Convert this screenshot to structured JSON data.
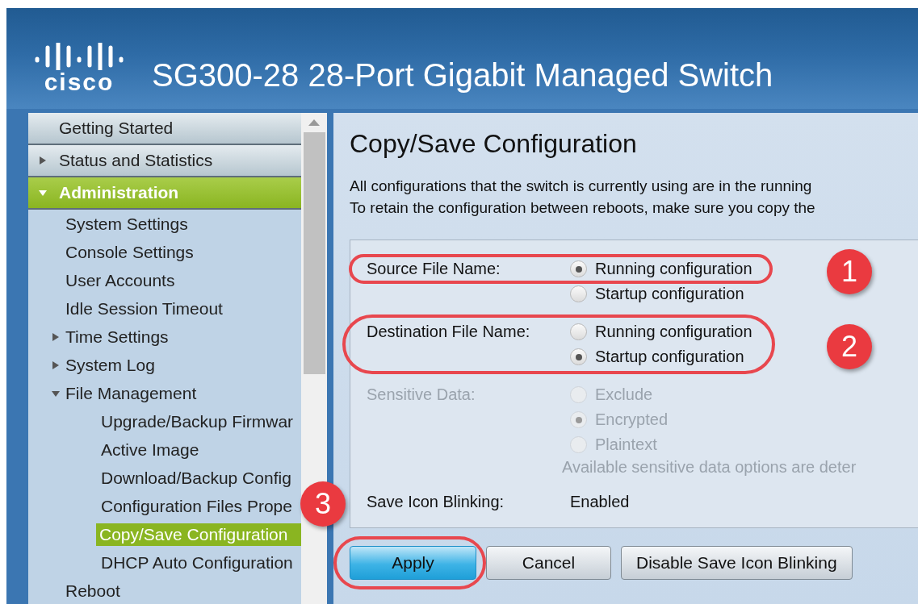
{
  "header": {
    "logo": "cisco",
    "title": "SG300-28 28-Port Gigabit Managed Switch"
  },
  "sidebar": {
    "items": [
      {
        "label": "Getting Started",
        "selected": false
      },
      {
        "label": "Status and Statistics",
        "expanded": false,
        "selected": false
      },
      {
        "label": "Administration",
        "expanded": true,
        "selected": true,
        "children": [
          {
            "label": "System Settings",
            "selected": false
          },
          {
            "label": "Console Settings",
            "selected": false
          },
          {
            "label": "User Accounts",
            "selected": false
          },
          {
            "label": "Idle Session Timeout",
            "selected": false
          },
          {
            "label": "Time Settings",
            "expanded": false,
            "selected": false
          },
          {
            "label": "System Log",
            "expanded": false,
            "selected": false
          },
          {
            "label": "File Management",
            "expanded": true,
            "selected": false,
            "children": [
              {
                "label": "Upgrade/Backup Firmwar",
                "selected": false
              },
              {
                "label": "Active Image",
                "selected": false
              },
              {
                "label": "Download/Backup Config",
                "selected": false
              },
              {
                "label": "Configuration Files Prope",
                "selected": false
              },
              {
                "label": "Copy/Save Configuration",
                "selected": true
              },
              {
                "label": "DHCP Auto Configuration",
                "selected": false
              }
            ]
          },
          {
            "label": "Reboot",
            "selected": false
          }
        ]
      }
    ]
  },
  "content": {
    "title": "Copy/Save Configuration",
    "description": [
      "All configurations that the switch is currently using are in the running",
      "To retain the configuration between reboots, make sure you copy the"
    ],
    "form": [
      {
        "kind": "radio",
        "label": "Source File Name:",
        "disabled": false,
        "options": [
          {
            "label": "Running configuration",
            "selected": true,
            "highlighted": true
          },
          {
            "label": "Startup configuration",
            "selected": false,
            "highlighted": false
          }
        ]
      },
      {
        "kind": "radio",
        "label": "Destination File Name:",
        "disabled": false,
        "options": [
          {
            "label": "Running configuration",
            "selected": false,
            "highlighted": true
          },
          {
            "label": "Startup configuration",
            "selected": true,
            "highlighted": true
          }
        ]
      },
      {
        "kind": "radio",
        "label": "Sensitive Data:",
        "disabled": true,
        "options": [
          {
            "label": "Exclude",
            "selected": false,
            "highlighted": false
          },
          {
            "label": "Encrypted",
            "selected": true,
            "highlighted": false
          },
          {
            "label": "Plaintext",
            "selected": false,
            "highlighted": false
          }
        ],
        "note": "Available sensitive data options are deter"
      },
      {
        "kind": "text",
        "label": "Save Icon Blinking:",
        "value": "Enabled"
      }
    ],
    "buttons": [
      {
        "label": "Apply",
        "kind": "primary",
        "ringed": true
      },
      {
        "label": "Cancel",
        "kind": "normal",
        "ringed": false
      },
      {
        "label": "Disable Save Icon Blinking",
        "kind": "normal",
        "ringed": false
      }
    ]
  },
  "step_badges": [
    "1",
    "2",
    "3"
  ]
}
